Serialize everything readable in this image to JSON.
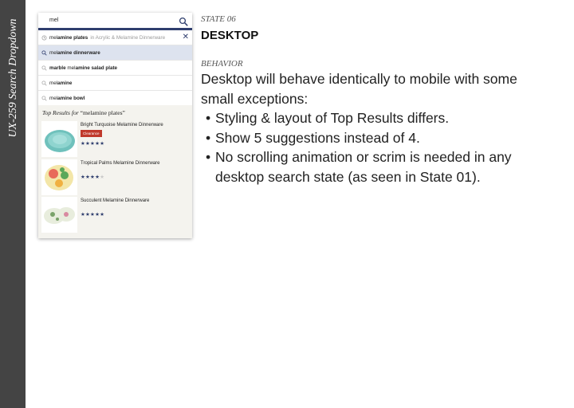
{
  "sidebar": {
    "title": "UX-259 Search Dropdown"
  },
  "search": {
    "query": "mel"
  },
  "suggestions": [
    {
      "prefix": "mel",
      "completion": "amine plates",
      "context": "in Acrylic & Melamine Dinnerware",
      "type": "recent"
    },
    {
      "prefix": "mel",
      "completion": "amine dinnerware",
      "type": "search"
    },
    {
      "lead": "marble ",
      "prefix": "mel",
      "completion": "amine salad plate",
      "type": "search"
    },
    {
      "prefix": "mel",
      "completion": "amine",
      "type": "search"
    },
    {
      "prefix": "mel",
      "completion": "amine bowl",
      "type": "search"
    }
  ],
  "top_results": {
    "heading_prefix": "Top Results for",
    "heading_query": "“melamine plates”",
    "products": [
      {
        "name": "Bright Turquoise Melamine Dinnerware",
        "badge": "Clearance",
        "rating": 5,
        "stars": "★★★★★"
      },
      {
        "name": "Tropical Palms Melamine Dinnerware",
        "rating": 4,
        "stars": "★★★★",
        "stars_empty": "★"
      },
      {
        "name": "Succulent Melamine Dinnerware",
        "rating": 5,
        "stars": "★★★★★"
      }
    ]
  },
  "state": {
    "label": "STATE 06",
    "name": "DESKTOP"
  },
  "behavior": {
    "label": "BEHAVIOR",
    "intro": "Desktop will behave identically to mobile with some small exceptions:",
    "bullets": [
      "Styling & layout of Top Results differs.",
      "Show 5 suggestions instead of 4.",
      "No scrolling animation or scrim is needed in any desktop search state (as seen in State 01)."
    ]
  },
  "colors": {
    "sidebar": "#444444",
    "accent": "#2f3e6e",
    "highlight": "#dde3ef",
    "badge": "#c0392b",
    "panel": "#f4f3ee"
  }
}
